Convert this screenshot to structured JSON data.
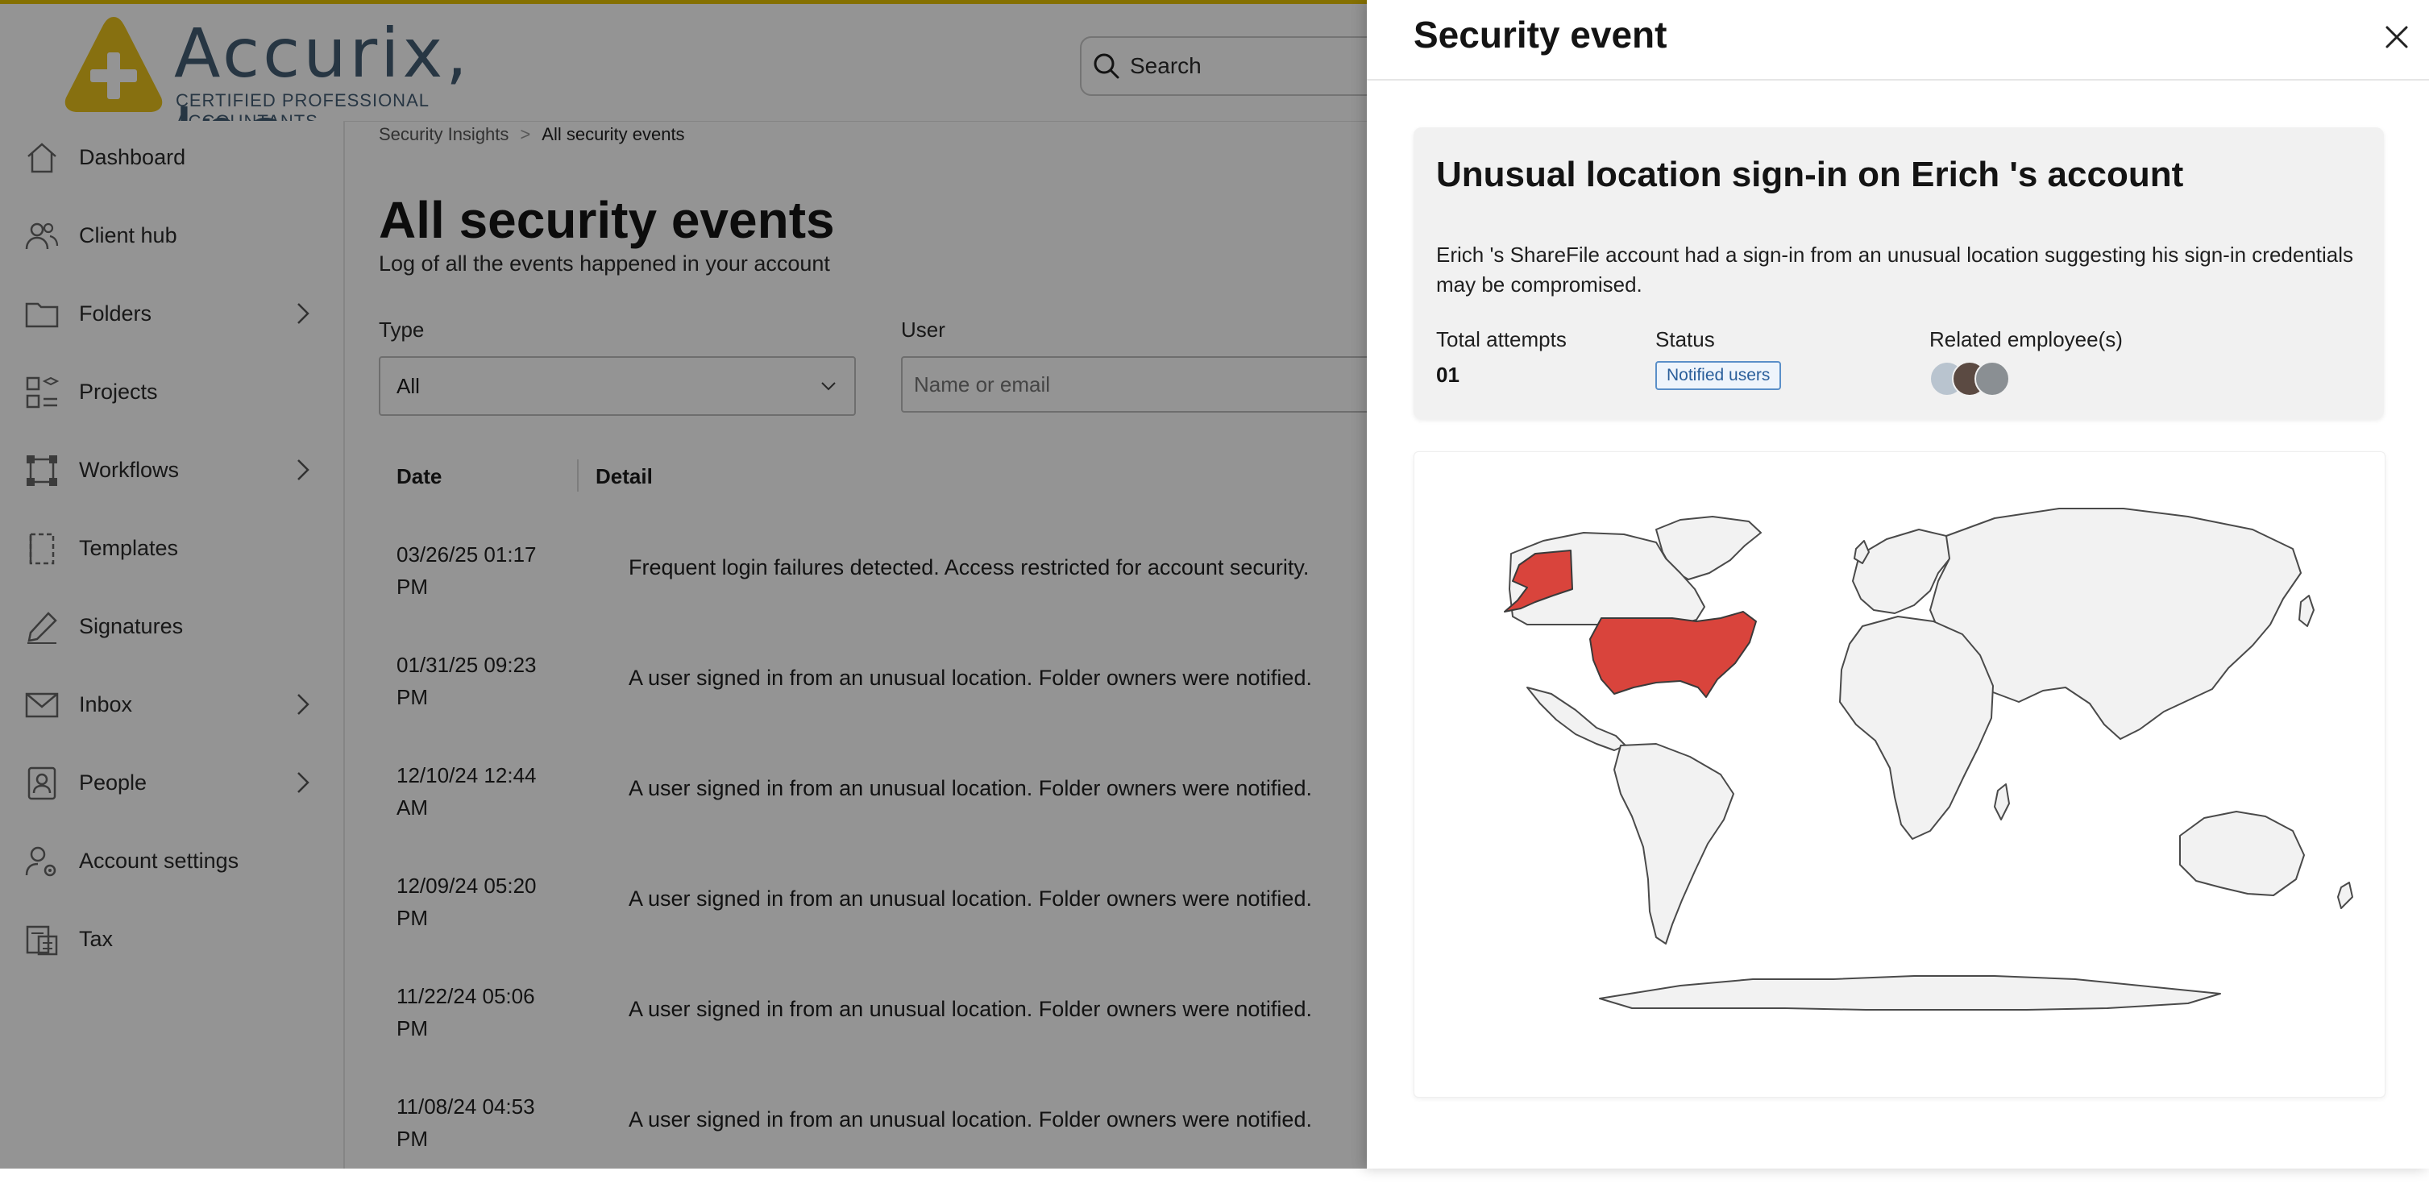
{
  "company": {
    "name": "Accurix, Inc.",
    "tagline": "CERTIFIED PROFESSIONAL ACCOUNTANTS"
  },
  "search": {
    "placeholder": "Search"
  },
  "sidebar": {
    "items": [
      {
        "label": "Dashboard",
        "icon": "home-icon",
        "has_submenu": false
      },
      {
        "label": "Client hub",
        "icon": "users-icon",
        "has_submenu": false
      },
      {
        "label": "Folders",
        "icon": "folder-icon",
        "has_submenu": true
      },
      {
        "label": "Projects",
        "icon": "projects-icon",
        "has_submenu": false
      },
      {
        "label": "Workflows",
        "icon": "workflow-icon",
        "has_submenu": true
      },
      {
        "label": "Templates",
        "icon": "template-icon",
        "has_submenu": false
      },
      {
        "label": "Signatures",
        "icon": "pen-icon",
        "has_submenu": false
      },
      {
        "label": "Inbox",
        "icon": "envelope-icon",
        "has_submenu": true
      },
      {
        "label": "People",
        "icon": "person-badge-icon",
        "has_submenu": true
      },
      {
        "label": "Account settings",
        "icon": "user-gear-icon",
        "has_submenu": false
      },
      {
        "label": "Tax",
        "icon": "tax-icon",
        "has_submenu": false
      }
    ]
  },
  "breadcrumb": {
    "parent": "Security Insights",
    "separator": ">",
    "current": "All security events"
  },
  "page": {
    "title": "All security events",
    "subtitle": "Log of all the events happened in your account"
  },
  "filters": {
    "type_label": "Type",
    "type_value": "All",
    "user_label": "User",
    "user_placeholder": "Name or email"
  },
  "table": {
    "columns": [
      "Date",
      "Detail"
    ],
    "rows": [
      {
        "date": "03/26/25 01:17 PM",
        "detail": "Frequent login failures detected. Access restricted for account security."
      },
      {
        "date": "01/31/25 09:23 PM",
        "detail": "A user signed in from an unusual location. Folder owners were notified."
      },
      {
        "date": "12/10/24 12:44 AM",
        "detail": "A user signed in from an unusual location. Folder owners were notified."
      },
      {
        "date": "12/09/24 05:20 PM",
        "detail": "A user signed in from an unusual location. Folder owners were notified."
      },
      {
        "date": "11/22/24 05:06 PM",
        "detail": "A user signed in from an unusual location. Folder owners were notified."
      },
      {
        "date": "11/08/24 04:53 PM",
        "detail": "A user signed in from an unusual location. Folder owners were notified."
      }
    ]
  },
  "panel": {
    "title": "Security event",
    "event_title": "Unusual location sign-in on Erich 's account",
    "description": "Erich 's ShareFile account had a sign-in from an unusual location suggesting his sign-in credentials may be compromised.",
    "attempts_label": "Total attempts",
    "attempts_value": "01",
    "status_label": "Status",
    "status_value": "Notified users",
    "employees_label": "Related employee(s)",
    "employee_count": 3,
    "map": {
      "highlighted_region": "United States",
      "highlight_color": "#d9443c",
      "land_color": "#f2f2f2"
    }
  },
  "colors": {
    "accent": "#e6c200",
    "brand": "#445d74",
    "badge": "#5a8fc8"
  }
}
